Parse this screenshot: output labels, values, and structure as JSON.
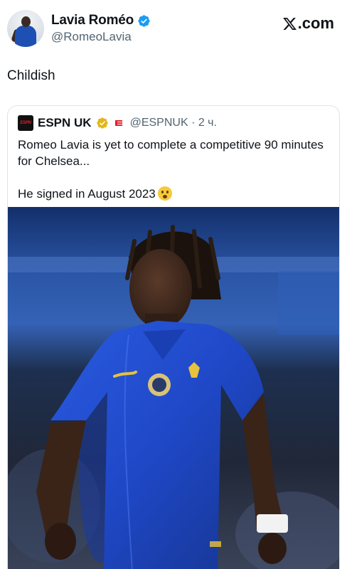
{
  "author": {
    "display_name": "Lavia Roméo",
    "handle": "@RomeoLavia",
    "avatar_icon": "profile-photo",
    "verified_icon": "blue-verified-badge"
  },
  "brand": {
    "label": ".com",
    "logo_icon": "x-logo"
  },
  "tweet": {
    "text": "Childish"
  },
  "quoted": {
    "logo_icon": "espn-logo",
    "logo_text": "ESPN",
    "name": "ESPN UK",
    "badge_icon": "gold-verified-badge",
    "handle_time": "@ESPNUK · 2 ч.",
    "text_line1": "Romeo Lavia is yet to complete a competitive 90 minutes for Chelsea...",
    "text_line2": "He signed in August 2023",
    "emoji_icon": "surprised-face-emoji"
  },
  "colors": {
    "verified_blue": "#1d9bf0",
    "gold": "#e2b719",
    "kit_blue": "#1f48c7",
    "espn_red": "#e0202b"
  }
}
